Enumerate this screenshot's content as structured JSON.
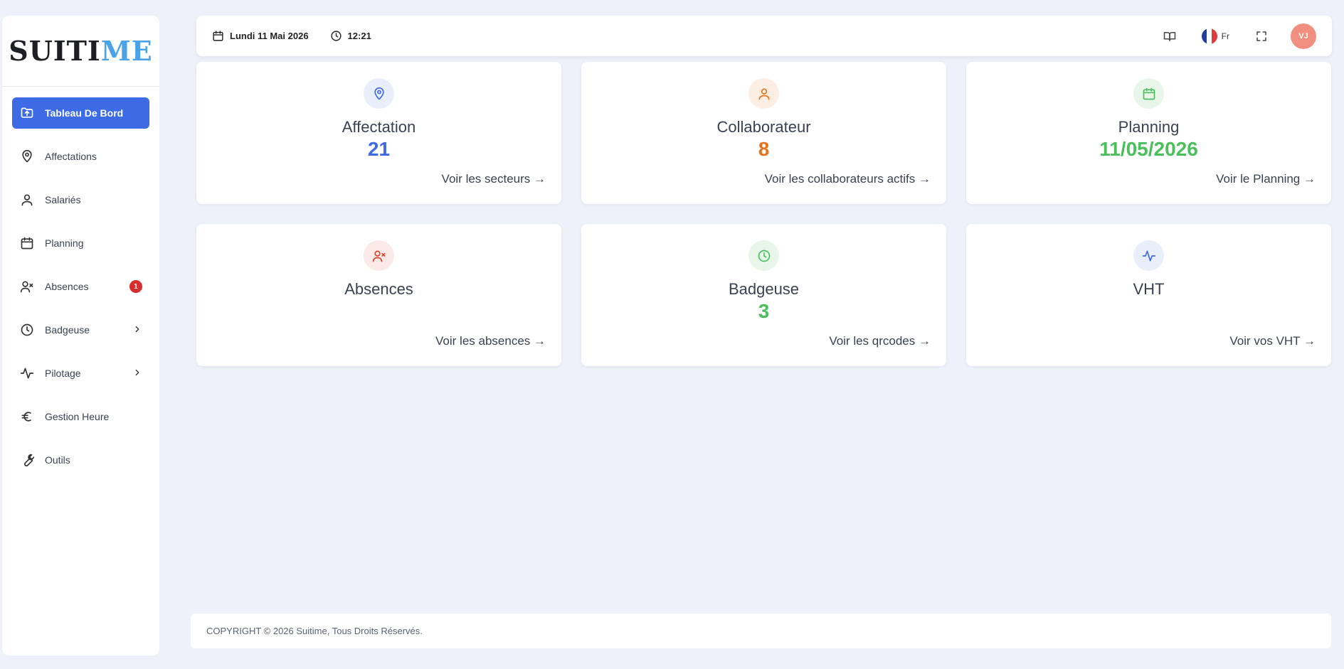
{
  "brand": {
    "logo_left": "SUIT",
    "logo_mid": "I",
    "logo_right": "ME"
  },
  "sidebar": {
    "items": [
      {
        "label": "Tableau De Bord",
        "icon": "folder-upload-icon"
      },
      {
        "label": "Affectations",
        "icon": "map-pin-icon"
      },
      {
        "label": "Salariés",
        "icon": "user-icon"
      },
      {
        "label": "Planning",
        "icon": "calendar-icon"
      },
      {
        "label": "Absences",
        "icon": "user-x-icon",
        "badge": "1"
      },
      {
        "label": "Badgeuse",
        "icon": "clock-icon"
      },
      {
        "label": "Pilotage",
        "icon": "activity-icon"
      },
      {
        "label": "Gestion Heure",
        "icon": "euro-icon"
      },
      {
        "label": "Outils",
        "icon": "wrench-icon"
      }
    ]
  },
  "header": {
    "date": "Lundi 11 Mai 2026",
    "time": "12:21",
    "language": "Fr",
    "avatar_initials": "VJ"
  },
  "cards": [
    {
      "title": "Affectation",
      "value": "21",
      "link": "Voir les secteurs →",
      "color": "#3d6be6",
      "icon": "map-pin-icon"
    },
    {
      "title": "Collaborateur",
      "value": "8",
      "link": "Voir les collaborateurs actifs →",
      "color": "#e8731c",
      "icon": "user-icon"
    },
    {
      "title": "Planning",
      "value": "11/05/2026",
      "link": "Voir le Planning →",
      "color": "#4bbf5c",
      "icon": "calendar-icon"
    },
    {
      "title": "Absences",
      "value": "",
      "link": "Voir les absences →",
      "color": "#d9442d",
      "icon": "user-x-icon"
    },
    {
      "title": "Badgeuse",
      "value": "3",
      "link": "Voir les qrcodes →",
      "color": "#4bbf5c",
      "icon": "clock-icon"
    },
    {
      "title": "VHT",
      "value": "",
      "link": "Voir vos VHT →",
      "color": "#3d6be6",
      "icon": "activity-icon"
    }
  ],
  "footer": {
    "copyright": "COPYRIGHT © 2026 Suitime, Tous Droits Réservés."
  },
  "colors": {
    "accent": "#3d6be6",
    "background": "#eef1f9",
    "badge": "#d92d2d",
    "avatar": "#f08f7f"
  }
}
